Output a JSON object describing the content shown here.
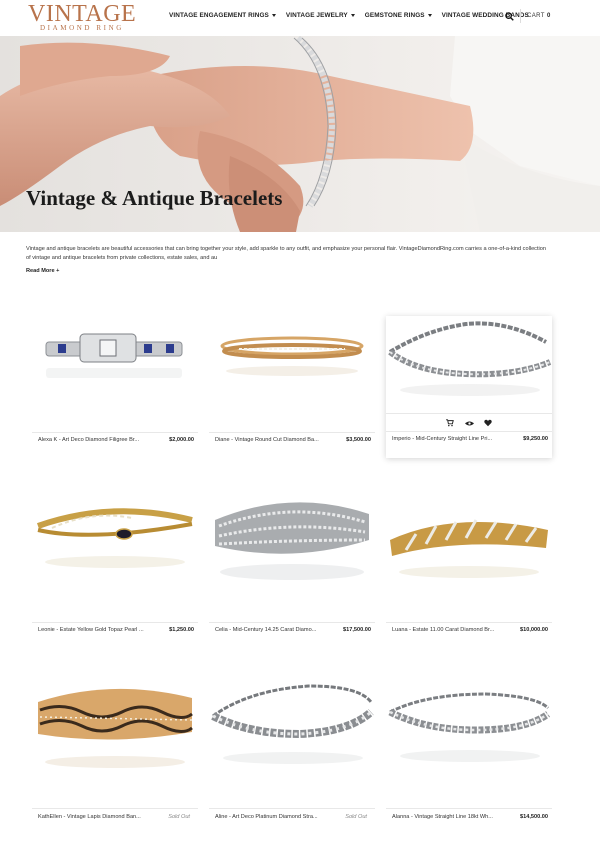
{
  "header": {
    "logo_main": "VINTAGE",
    "logo_sub": "DIAMOND RING",
    "nav": [
      {
        "label": "VINTAGE ENGAGEMENT RINGS",
        "has_dropdown": true
      },
      {
        "label": "VINTAGE JEWELRY",
        "has_dropdown": true
      },
      {
        "label": "GEMSTONE RINGS",
        "has_dropdown": true
      },
      {
        "label": "VINTAGE WEDDING BANDS",
        "has_dropdown": false
      }
    ],
    "search_icon": "search-icon",
    "cart_label": "CART",
    "cart_count": "0"
  },
  "hero": {
    "title": "Vintage & Antique Bracelets"
  },
  "intro": {
    "text": "Vintage and antique bracelets are beautiful accessories that can bring together your style, add sparkle to any outfit, and emphasize your personal flair. VintageDiamondRing.com carries a one-of-a-kind collection of vintage and antique bracelets from private collections, estate sales, and au",
    "read_more": "Read More +"
  },
  "products": [
    {
      "name": "Alexa K - Art Deco Diamond Filigree Br...",
      "price": "$2,000.00",
      "sold_out": false
    },
    {
      "name": "Diane - Vintage Round Cut Diamond Ba...",
      "price": "$3,500.00",
      "sold_out": false
    },
    {
      "name": "Imperio - Mid-Century Straight Line Pri...",
      "price": "$9,250.00",
      "sold_out": false
    },
    {
      "name": "Leonie - Estate Yellow Gold Topaz Pearl ...",
      "price": "$1,250.00",
      "sold_out": false
    },
    {
      "name": "Celia - Mid-Century 14.25 Carat Diamo...",
      "price": "$17,500.00",
      "sold_out": false
    },
    {
      "name": "Luana - Estate 11.00 Carat Diamond Br...",
      "price": "$10,000.00",
      "sold_out": false
    },
    {
      "name": "KathEllen - Vintage Lapis Diamond Ban...",
      "price": "Sold Out",
      "sold_out": true
    },
    {
      "name": "Aline - Art Deco Platinum Diamond Stra...",
      "price": "Sold Out",
      "sold_out": true
    },
    {
      "name": "Alanna - Vintage Straight Line 18kt Wh...",
      "price": "$14,500.00",
      "sold_out": false
    }
  ],
  "hover_actions": [
    "cart-icon",
    "eye-icon",
    "heart-icon"
  ],
  "colors": {
    "brand": "#b8734b",
    "text": "#222222"
  }
}
